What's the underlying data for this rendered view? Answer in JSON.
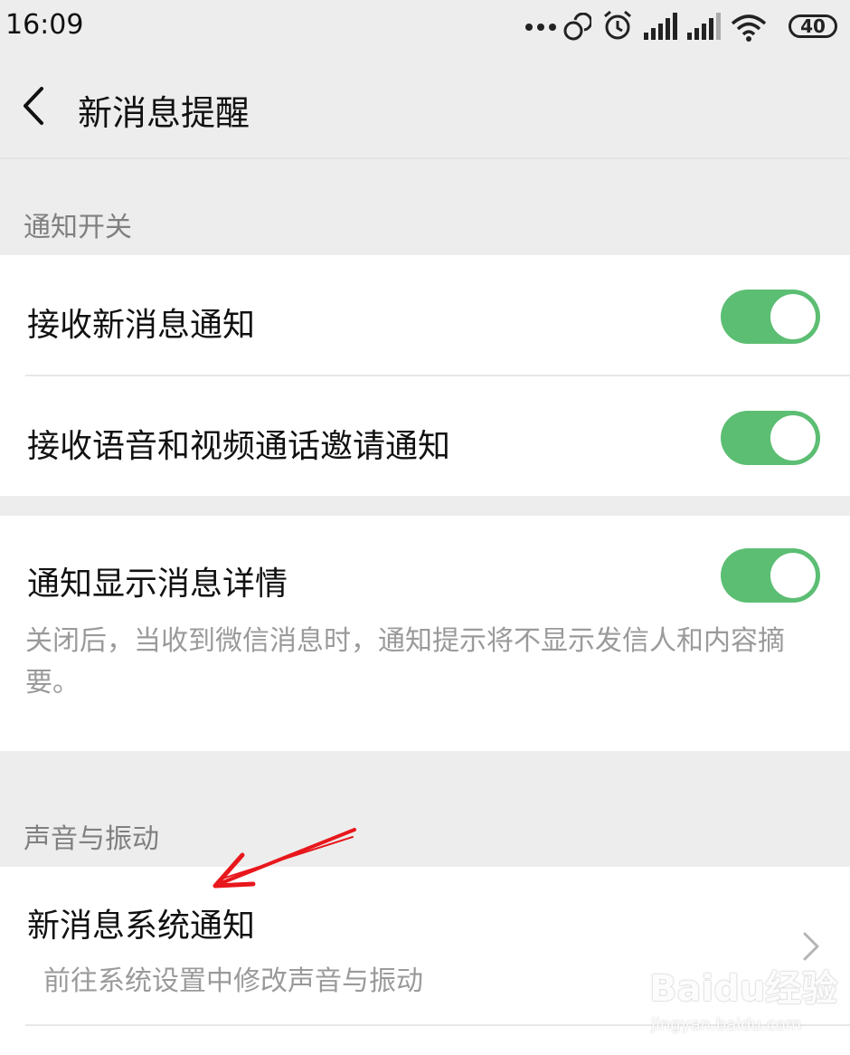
{
  "status_bar": {
    "time": "16:09",
    "battery": "40",
    "icons": [
      "more-dots-icon",
      "sync-icon",
      "alarm-icon",
      "signal-icon",
      "signal-icon",
      "wifi-icon",
      "battery-icon"
    ]
  },
  "nav": {
    "back_icon": "chevron-left-icon",
    "title": "新消息提醒"
  },
  "sections": {
    "notify_switch": {
      "label": "通知开关",
      "rows": [
        {
          "title": "接收新消息通知",
          "toggle_on": true
        },
        {
          "title": "接收语音和视频通话邀请通知",
          "toggle_on": true
        }
      ]
    },
    "details": {
      "title": "通知显示消息详情",
      "toggle_on": true,
      "description": "关闭后，当收到微信消息时，通知提示将不显示发信人和内容摘要。"
    },
    "sound_vibration": {
      "label": "声音与振动",
      "row": {
        "title": "新消息系统通知",
        "subtitle": "前往系统设置中修改声音与振动",
        "chevron": "chevron-right-icon"
      }
    }
  },
  "colors": {
    "toggle_on": "#5cbe73",
    "background": "#ededed",
    "annotation_arrow": "#e8171c"
  },
  "watermark": {
    "main": "Baidu经验",
    "sub": "jingyan.baidu.com"
  }
}
